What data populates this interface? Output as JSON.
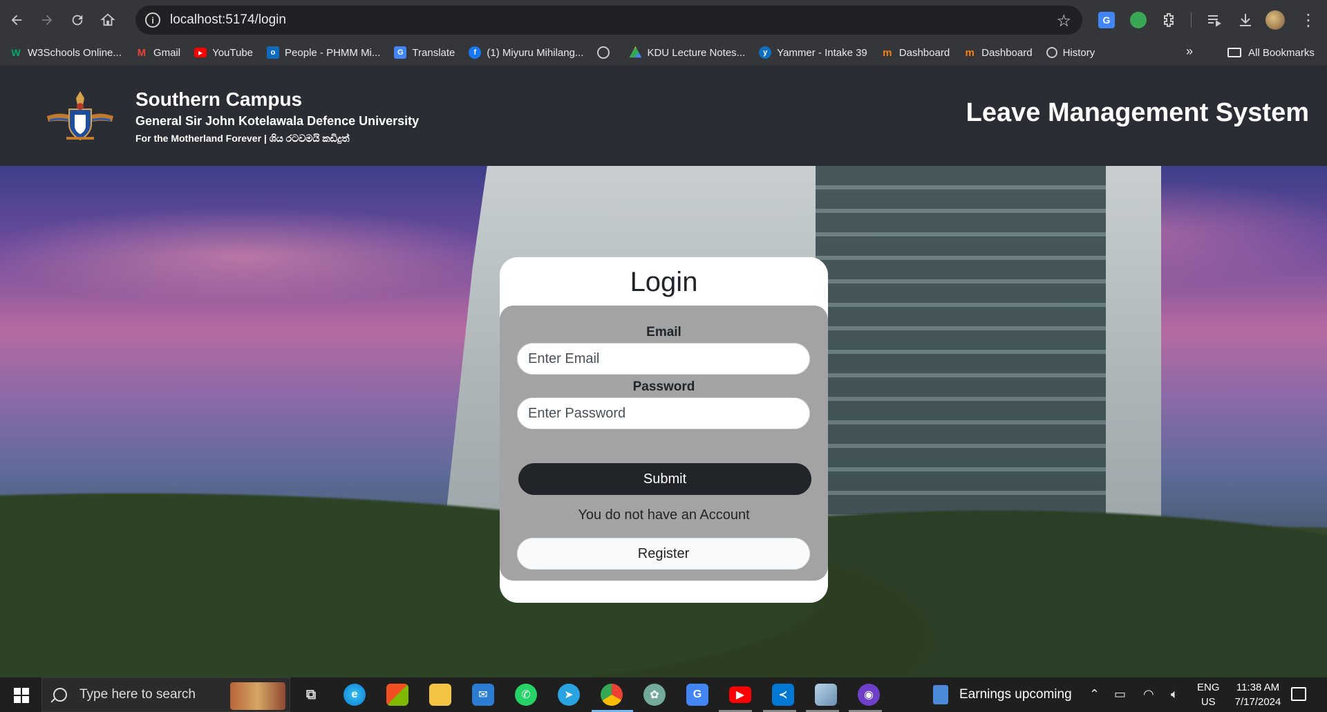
{
  "browser": {
    "url": "localhost:5174/login",
    "bookmarks": [
      {
        "label": "W3Schools Online...",
        "icon": "w3schools-icon",
        "color": "#04aa6d"
      },
      {
        "label": "Gmail",
        "icon": "gmail-icon",
        "color": "#ea4335"
      },
      {
        "label": "YouTube",
        "icon": "youtube-icon",
        "color": "#ff0000"
      },
      {
        "label": "People - PHMM Mi...",
        "icon": "outlook-icon",
        "color": "#0f6cbd"
      },
      {
        "label": "Translate",
        "icon": "translate-icon",
        "color": "#4285f4"
      },
      {
        "label": "(1) Miyuru Mihilang...",
        "icon": "facebook-icon",
        "color": "#1877f2"
      },
      {
        "label": "",
        "icon": "globe-icon",
        "color": "#9aa0a6"
      },
      {
        "label": "KDU Lecture Notes...",
        "icon": "drive-icon",
        "color": "#34a853"
      },
      {
        "label": "Yammer - Intake 39",
        "icon": "yammer-icon",
        "color": "#106ebe"
      },
      {
        "label": "Dashboard",
        "icon": "moodle-icon",
        "color": "#f98012"
      },
      {
        "label": "Dashboard",
        "icon": "moodle-icon",
        "color": "#f98012"
      },
      {
        "label": "History",
        "icon": "history-icon",
        "color": "#9aa0a6"
      }
    ],
    "all_bookmarks_label": "All Bookmarks"
  },
  "header": {
    "campus_name": "Southern Campus",
    "university": "General Sir John Kotelawala Defence University",
    "motto": "For the Motherland Forever | ශිය රටවමයි කඩිදුත්",
    "system_title": "Leave Management System"
  },
  "login": {
    "title": "Login",
    "email_label": "Email",
    "email_placeholder": "Enter Email",
    "password_label": "Password",
    "password_placeholder": "Enter Password",
    "submit_label": "Submit",
    "no_account_text": "You do not have an Account",
    "register_label": "Register"
  },
  "taskbar": {
    "search_placeholder": "Type here to search",
    "news_text": "Earnings upcoming",
    "lang_top": "ENG",
    "lang_bottom": "US",
    "time": "11:38 AM",
    "date": "7/17/2024"
  },
  "colors": {
    "header_bg": "#2a2d33",
    "button_dark": "#212529",
    "panel_gray": "#a3a3a3"
  }
}
